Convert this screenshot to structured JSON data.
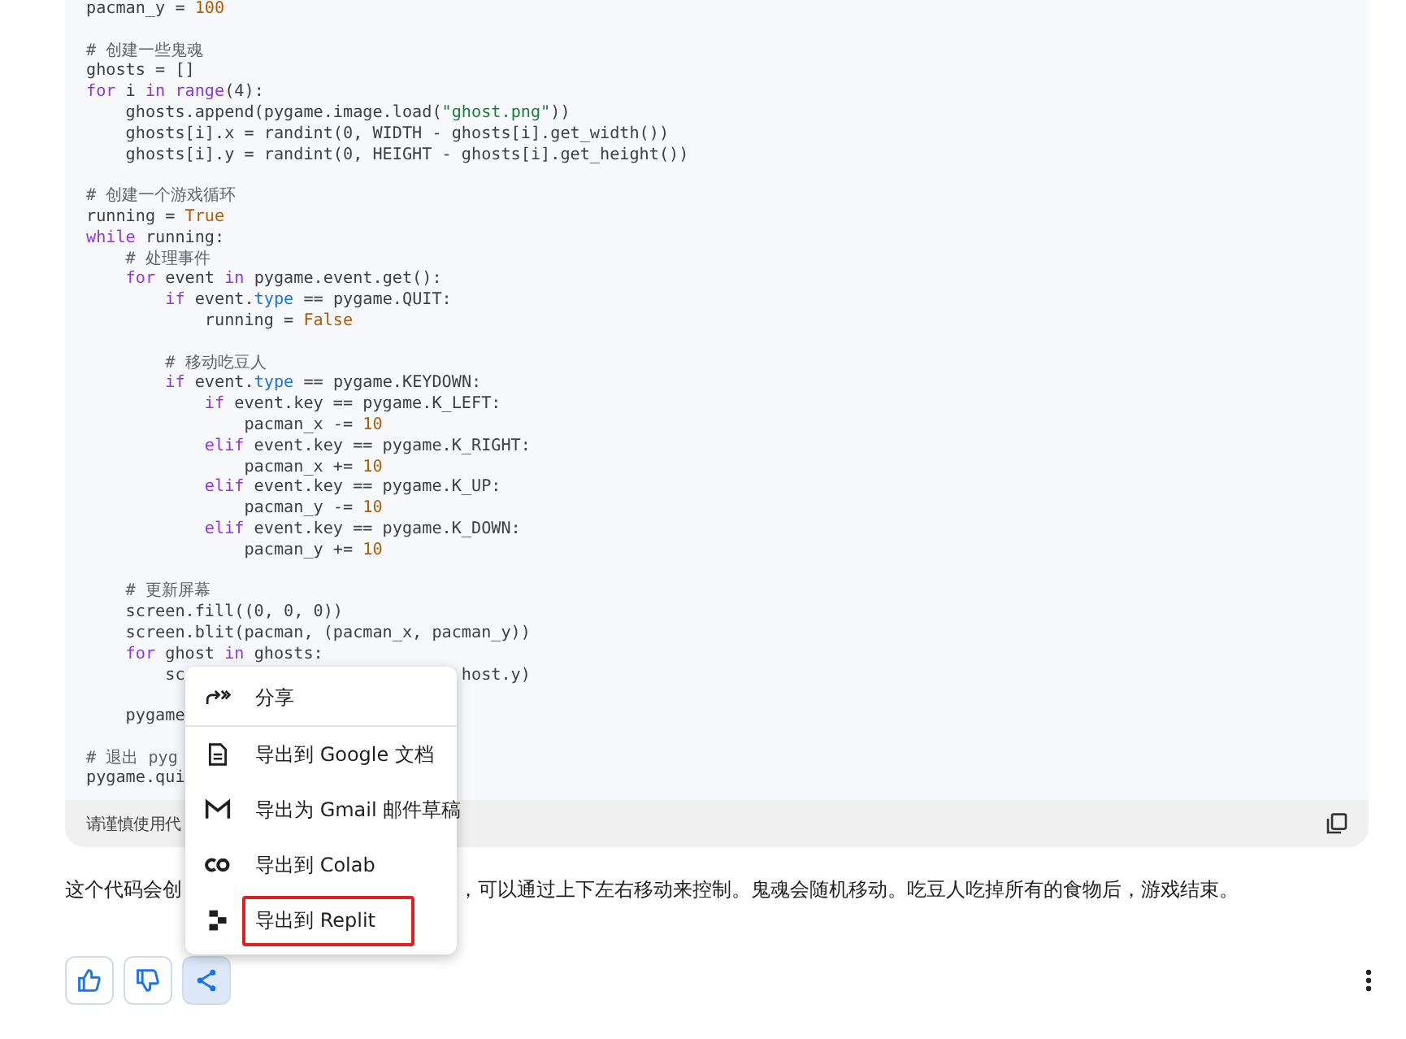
{
  "code_block": {
    "groups": [
      [
        {
          "tokens": [
            {
              "kind": "plain",
              "text": "pacman_y = "
            },
            {
              "kind": "number",
              "text": "100"
            }
          ]
        }
      ],
      [
        {
          "tokens": [
            {
              "kind": "comment",
              "text": "# 创建一些鬼魂"
            }
          ]
        },
        {
          "tokens": [
            {
              "kind": "plain",
              "text": "ghosts = []"
            }
          ]
        },
        {
          "tokens": [
            {
              "kind": "keyword",
              "text": "for"
            },
            {
              "kind": "plain",
              "text": " i "
            },
            {
              "kind": "keyword",
              "text": "in range"
            },
            {
              "kind": "plain",
              "text": "(4):"
            }
          ]
        },
        {
          "tokens": [
            {
              "kind": "plain",
              "text": "    ghosts.append(pygame.image.load("
            },
            {
              "kind": "string",
              "text": "\"ghost.png\""
            },
            {
              "kind": "plain",
              "text": "))"
            }
          ]
        },
        {
          "tokens": [
            {
              "kind": "plain",
              "text": "    ghosts[i].x = randint(0, WIDTH - ghosts[i].get_width())"
            }
          ]
        },
        {
          "tokens": [
            {
              "kind": "plain",
              "text": "    ghosts[i].y = randint(0, HEIGHT - ghosts[i].get_height())"
            }
          ]
        }
      ],
      [
        {
          "tokens": [
            {
              "kind": "comment",
              "text": "# 创建一个游戏循环"
            }
          ]
        },
        {
          "tokens": [
            {
              "kind": "plain",
              "text": "running = "
            },
            {
              "kind": "number",
              "text": "True"
            }
          ]
        },
        {
          "tokens": [
            {
              "kind": "keyword",
              "text": "while"
            },
            {
              "kind": "plain",
              "text": " running:"
            }
          ]
        },
        {
          "tokens": [
            {
              "kind": "comment",
              "text": "    # 处理事件"
            }
          ]
        },
        {
          "tokens": [
            {
              "kind": "keyword",
              "text": "    for"
            },
            {
              "kind": "plain",
              "text": " event "
            },
            {
              "kind": "keyword",
              "text": "in"
            },
            {
              "kind": "plain",
              "text": " pygame.event.get():"
            }
          ]
        },
        {
          "tokens": [
            {
              "kind": "keyword",
              "text": "        if"
            },
            {
              "kind": "plain",
              "text": " event."
            },
            {
              "kind": "attribute",
              "text": "type"
            },
            {
              "kind": "plain",
              "text": " == pygame.QUIT:"
            }
          ]
        },
        {
          "tokens": [
            {
              "kind": "plain",
              "text": "            running = "
            },
            {
              "kind": "number",
              "text": "False"
            }
          ]
        }
      ],
      [
        {
          "tokens": [
            {
              "kind": "comment",
              "text": "        # 移动吃豆人"
            }
          ]
        },
        {
          "tokens": [
            {
              "kind": "keyword",
              "text": "        if"
            },
            {
              "kind": "plain",
              "text": " event."
            },
            {
              "kind": "attribute",
              "text": "type"
            },
            {
              "kind": "plain",
              "text": " == pygame.KEYDOWN:"
            }
          ]
        },
        {
          "tokens": [
            {
              "kind": "keyword",
              "text": "            if"
            },
            {
              "kind": "plain",
              "text": " event.key == pygame.K_LEFT:"
            }
          ]
        },
        {
          "tokens": [
            {
              "kind": "plain",
              "text": "                pacman_x -= "
            },
            {
              "kind": "number",
              "text": "10"
            }
          ]
        },
        {
          "tokens": [
            {
              "kind": "keyword",
              "text": "            elif"
            },
            {
              "kind": "plain",
              "text": " event.key == pygame.K_RIGHT:"
            }
          ]
        },
        {
          "tokens": [
            {
              "kind": "plain",
              "text": "                pacman_x += "
            },
            {
              "kind": "number",
              "text": "10"
            }
          ]
        },
        {
          "tokens": [
            {
              "kind": "keyword",
              "text": "            elif"
            },
            {
              "kind": "plain",
              "text": " event.key == pygame.K_UP:"
            }
          ]
        },
        {
          "tokens": [
            {
              "kind": "plain",
              "text": "                pacman_y -= "
            },
            {
              "kind": "number",
              "text": "10"
            }
          ]
        },
        {
          "tokens": [
            {
              "kind": "keyword",
              "text": "            elif"
            },
            {
              "kind": "plain",
              "text": " event.key == pygame.K_DOWN:"
            }
          ]
        },
        {
          "tokens": [
            {
              "kind": "plain",
              "text": "                pacman_y += "
            },
            {
              "kind": "number",
              "text": "10"
            }
          ]
        }
      ],
      [
        {
          "tokens": [
            {
              "kind": "comment",
              "text": "    # 更新屏幕"
            }
          ]
        },
        {
          "tokens": [
            {
              "kind": "plain",
              "text": "    screen.fill((0, 0, 0))"
            }
          ]
        },
        {
          "tokens": [
            {
              "kind": "plain",
              "text": "    screen.blit(pacman, (pacman_x, pacman_y))"
            }
          ]
        },
        {
          "tokens": [
            {
              "kind": "keyword",
              "text": "    for"
            },
            {
              "kind": "plain",
              "text": " ghost "
            },
            {
              "kind": "keyword",
              "text": "in"
            },
            {
              "kind": "plain",
              "text": " ghosts:"
            }
          ]
        },
        {
          "tokens": [
            {
              "kind": "plain",
              "text": "        sc"
            }
          ],
          "tokens_after_menu": [
            {
              "kind": "plain",
              "text": "host.y)"
            }
          ]
        }
      ],
      [
        {
          "tokens": [
            {
              "kind": "plain",
              "text": "    pygame"
            }
          ]
        }
      ],
      [
        {
          "tokens": [
            {
              "kind": "comment",
              "text": "# 退出 pyg"
            }
          ]
        },
        {
          "tokens": [
            {
              "kind": "plain",
              "text": "pygame.qui"
            }
          ]
        }
      ]
    ],
    "footer_note": "请谨慎使用代"
  },
  "paragraph": {
    "before_menu": "这个代码会创",
    "after_menu": "，可以通过上下左右移动来控制。鬼魂会随机移动。吃豆人吃掉所有的食物后，游戏结束。"
  },
  "share_menu": {
    "sections": [
      [
        {
          "kind": "share",
          "label": "分享",
          "highlighted": false
        }
      ],
      [
        {
          "kind": "doc",
          "label": "导出到 Google 文档",
          "highlighted": false
        },
        {
          "kind": "gmail",
          "label": "导出为 Gmail 邮件草稿",
          "highlighted": false
        },
        {
          "kind": "colab",
          "label": "导出到 Colab",
          "highlighted": false
        },
        {
          "kind": "replit",
          "label": "导出到 Replit",
          "highlighted": true
        }
      ]
    ]
  },
  "actions": [
    {
      "kind": "like",
      "selected": false
    },
    {
      "kind": "dislike",
      "selected": false
    },
    {
      "kind": "share",
      "selected": true
    }
  ]
}
